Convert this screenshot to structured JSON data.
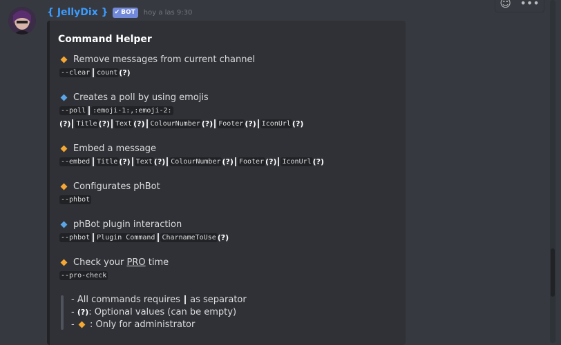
{
  "author": {
    "name": "{ JellyDix }",
    "bot_tag": "BOT",
    "timestamp": "hoy a las 9:30"
  },
  "embed": {
    "title": "Command Helper",
    "commands": [
      {
        "icon": "orange-diamond-icon",
        "description": "Remove messages from current channel",
        "syntax": [
          "--clear",
          "count"
        ]
      },
      {
        "icon": "blue-diamond-icon",
        "description": "Creates a poll by using emojis",
        "syntax_line1": [
          "--poll",
          ":emoji-1:,:emoji-2:"
        ],
        "syntax_line2": [
          "Title",
          "Text",
          "ColourNumber",
          "Footer",
          "IconUrl"
        ]
      },
      {
        "icon": "orange-diamond-icon",
        "description": "Embed a message",
        "syntax": [
          "--embed",
          "Title",
          "Text",
          "ColourNumber",
          "Footer",
          "IconUrl"
        ]
      },
      {
        "icon": "orange-diamond-icon",
        "description": "Configurates phBot",
        "syntax": [
          "--phbot"
        ]
      },
      {
        "icon": "blue-diamond-icon",
        "description": "phBot plugin interaction",
        "syntax": [
          "--phbot",
          "Plugin Command",
          "CharnameToUse"
        ]
      },
      {
        "icon": "orange-diamond-icon",
        "description_prefix": "Check your ",
        "description_link": "PRO",
        "description_suffix": " time",
        "syntax": [
          "--pro-check"
        ]
      }
    ],
    "notes": {
      "line1_a": "- All commands requires",
      "line1_b": "as separator",
      "line2_a": "-",
      "line2_b": ": Optional values (can be empty)",
      "line3_a": "-",
      "line3_b": ": Only for administrator"
    }
  },
  "symbols": {
    "question": "(?)"
  },
  "colors": {
    "username": "#3b9bff",
    "bot_tag": "#7289da",
    "diamond_orange": "#f4a732",
    "diamond_blue": "#5ba4e6"
  }
}
